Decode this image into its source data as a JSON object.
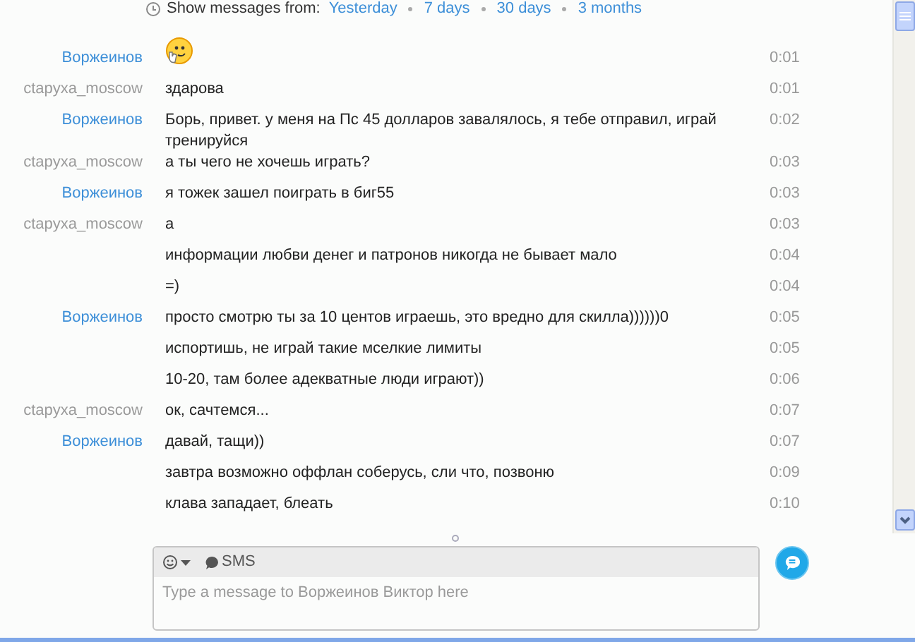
{
  "history_filter": {
    "label": "Show messages from:",
    "options": [
      "Yesterday",
      "7 days",
      "30 days",
      "3 months"
    ]
  },
  "messages": [
    {
      "kind": "emoticon",
      "sender": "Воржеинов",
      "color": "#3d8fd8",
      "time": "0:01"
    },
    {
      "kind": "text",
      "sender": "ctapyxa_moscow",
      "color": "#9a9a9a",
      "text": "здарова",
      "time": "0:01"
    },
    {
      "kind": "text",
      "sender": "Воржеинов",
      "color": "#3d8fd8",
      "text": "Борь, привет. у меня на Пс 45 долларов завалялось, я тебе отправил, играй тренируйся",
      "time": "0:02"
    },
    {
      "kind": "text",
      "sender": "ctapyxa_moscow",
      "color": "#9a9a9a",
      "text": "а ты чего не хочешь играть?",
      "time": "0:03"
    },
    {
      "kind": "text",
      "sender": "Воржеинов",
      "color": "#3d8fd8",
      "text": "я тожек зашел поиграть в биг55",
      "time": "0:03"
    },
    {
      "kind": "text",
      "sender": "ctapyxa_moscow",
      "color": "#9a9a9a",
      "text": "а",
      "time": "0:03"
    },
    {
      "kind": "text",
      "text": "информации любви денег и патронов никогда не бывает мало",
      "time": "0:04"
    },
    {
      "kind": "text",
      "text": "=)",
      "time": "0:04"
    },
    {
      "kind": "text",
      "sender": "Воржеинов",
      "color": "#3d8fd8",
      "text": "просто смотрю ты за 10 центов играешь, это вредно для скилла))))))0",
      "time": "0:05"
    },
    {
      "kind": "text",
      "text": "испортишь, не играй такие мселкие лимиты",
      "time": "0:05"
    },
    {
      "kind": "text",
      "text": "10-20, там более адекватные люди играют))",
      "time": "0:06"
    },
    {
      "kind": "text",
      "sender": "ctapyxa_moscow",
      "color": "#9a9a9a",
      "text": "ок, сачтемся...",
      "time": "0:07"
    },
    {
      "kind": "text",
      "sender": "Воржеинов",
      "color": "#3d8fd8",
      "text": "давай, тащи))",
      "time": "0:07"
    },
    {
      "kind": "text",
      "text": "завтра возможно оффлан соберусь, сли что, позвоню",
      "time": "0:09"
    },
    {
      "kind": "text",
      "text": "клава западает, блеать",
      "time": "0:10"
    }
  ],
  "composer": {
    "sms_label": "SMS",
    "placeholder": "Type a message to Воржеинов Виктор here"
  }
}
